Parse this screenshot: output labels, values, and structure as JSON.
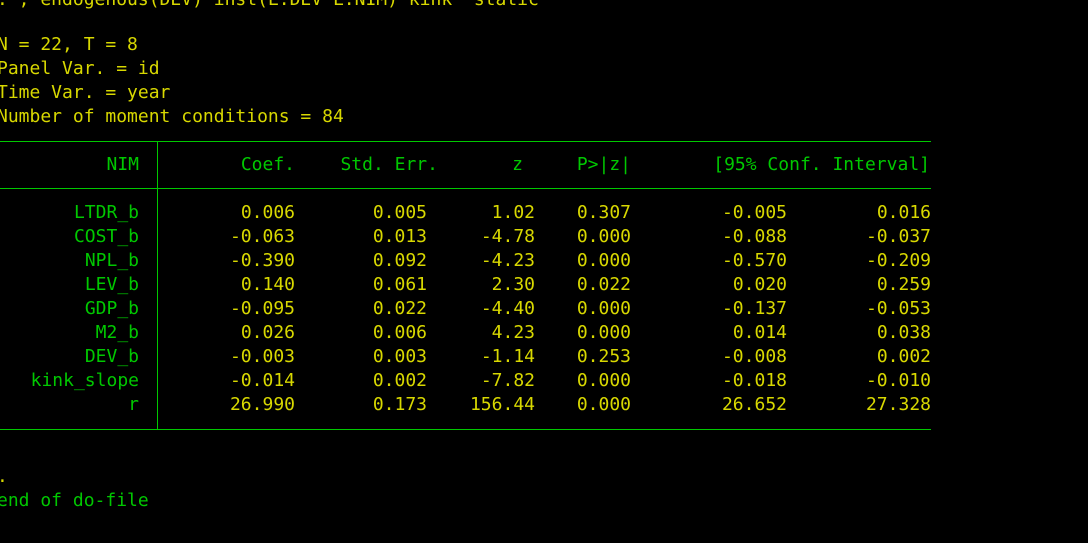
{
  "console": {
    "command_line": ". , endogenous(DEV) inst(L.DEV L.NIM) kink  static",
    "info_lines": [
      "N = 22, T = 8",
      "Panel Var. = id",
      "Time Var. = year",
      "Number of moment conditions = 84"
    ],
    "prompt_dot": ".",
    "end_message": "end of do-file"
  },
  "table": {
    "depvar": "NIM",
    "headers": [
      "Coef.",
      "Std. Err.",
      "z",
      "P>|z|",
      "[95% Conf. Interval]"
    ],
    "rows": [
      {
        "name": "LTDR_b",
        "values": [
          "0.006",
          "0.005",
          "1.02",
          "0.307",
          "-0.005",
          "0.016"
        ]
      },
      {
        "name": "COST_b",
        "values": [
          "-0.063",
          "0.013",
          "-4.78",
          "0.000",
          "-0.088",
          "-0.037"
        ]
      },
      {
        "name": "NPL_b",
        "values": [
          "-0.390",
          "0.092",
          "-4.23",
          "0.000",
          "-0.570",
          "-0.209"
        ]
      },
      {
        "name": "LEV_b",
        "values": [
          "0.140",
          "0.061",
          "2.30",
          "0.022",
          "0.020",
          "0.259"
        ]
      },
      {
        "name": "GDP_b",
        "values": [
          "-0.095",
          "0.022",
          "-4.40",
          "0.000",
          "-0.137",
          "-0.053"
        ]
      },
      {
        "name": "M2_b",
        "values": [
          "0.026",
          "0.006",
          "4.23",
          "0.000",
          "0.014",
          "0.038"
        ]
      },
      {
        "name": "DEV_b",
        "values": [
          "-0.003",
          "0.003",
          "-1.14",
          "0.253",
          "-0.008",
          "0.002"
        ]
      },
      {
        "name": "kink_slope",
        "values": [
          "-0.014",
          "0.002",
          "-7.82",
          "0.000",
          "-0.018",
          "-0.010"
        ]
      },
      {
        "name": "r",
        "values": [
          "26.990",
          "0.173",
          "156.44",
          "0.000",
          "26.652",
          "27.328"
        ]
      }
    ]
  },
  "colors": {
    "background": "#000000",
    "result_text": "#d8d800",
    "label_text": "#00c800"
  }
}
